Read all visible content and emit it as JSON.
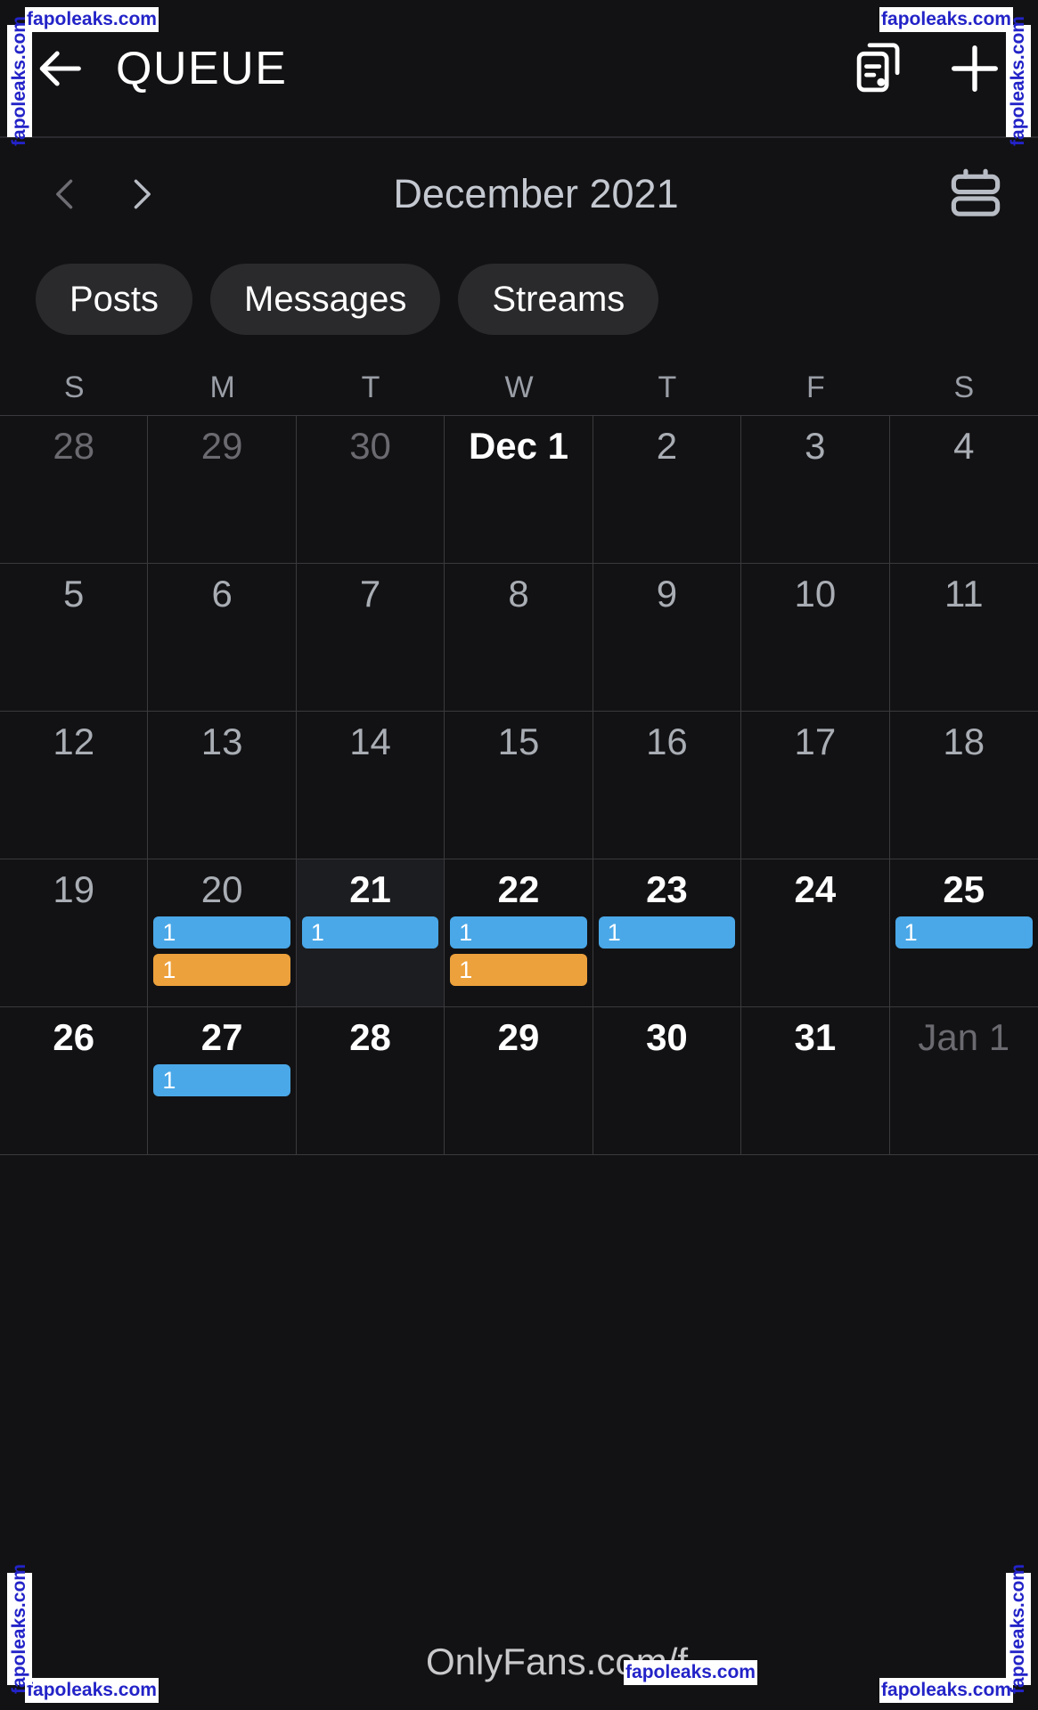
{
  "header": {
    "back_icon": "back-arrow-icon",
    "title": "QUEUE",
    "templates_icon": "post-templates-icon",
    "add_icon": "plus-icon"
  },
  "month_nav": {
    "prev_icon": "chevron-left-icon",
    "next_icon": "chevron-right-icon",
    "label": "December 2021",
    "view_toggle_icon": "agenda-view-icon"
  },
  "filters": [
    {
      "label": "Posts"
    },
    {
      "label": "Messages"
    },
    {
      "label": "Streams"
    }
  ],
  "weekdays": [
    "S",
    "M",
    "T",
    "W",
    "T",
    "F",
    "S"
  ],
  "colors": {
    "badge_blue": "#4aa8e8",
    "badge_orange": "#eda13c",
    "background": "#121214",
    "grid_line": "#3a3a3e",
    "today_cell": "#1c1d20"
  },
  "weeks": [
    [
      {
        "label": "28",
        "state": "muted",
        "badges": []
      },
      {
        "label": "29",
        "state": "muted",
        "badges": []
      },
      {
        "label": "30",
        "state": "muted",
        "badges": []
      },
      {
        "label": "Dec 1",
        "state": "normal",
        "badges": []
      },
      {
        "label": "2",
        "state": "dim",
        "badges": []
      },
      {
        "label": "3",
        "state": "dim",
        "badges": []
      },
      {
        "label": "4",
        "state": "dim",
        "badges": []
      }
    ],
    [
      {
        "label": "5",
        "state": "dim",
        "badges": []
      },
      {
        "label": "6",
        "state": "dim",
        "badges": []
      },
      {
        "label": "7",
        "state": "dim",
        "badges": []
      },
      {
        "label": "8",
        "state": "dim",
        "badges": []
      },
      {
        "label": "9",
        "state": "dim",
        "badges": []
      },
      {
        "label": "10",
        "state": "dim",
        "badges": []
      },
      {
        "label": "11",
        "state": "dim",
        "badges": []
      }
    ],
    [
      {
        "label": "12",
        "state": "dim",
        "badges": []
      },
      {
        "label": "13",
        "state": "dim",
        "badges": []
      },
      {
        "label": "14",
        "state": "dim",
        "badges": []
      },
      {
        "label": "15",
        "state": "dim",
        "badges": []
      },
      {
        "label": "16",
        "state": "dim",
        "badges": []
      },
      {
        "label": "17",
        "state": "dim",
        "badges": []
      },
      {
        "label": "18",
        "state": "dim",
        "badges": []
      }
    ],
    [
      {
        "label": "19",
        "state": "dim",
        "badges": []
      },
      {
        "label": "20",
        "state": "dim",
        "badges": [
          {
            "count": "1",
            "color": "blue"
          },
          {
            "count": "1",
            "color": "orange"
          }
        ]
      },
      {
        "label": "21",
        "state": "today",
        "badges": [
          {
            "count": "1",
            "color": "blue"
          }
        ]
      },
      {
        "label": "22",
        "state": "normal",
        "badges": [
          {
            "count": "1",
            "color": "blue"
          },
          {
            "count": "1",
            "color": "orange"
          }
        ]
      },
      {
        "label": "23",
        "state": "normal",
        "badges": [
          {
            "count": "1",
            "color": "blue"
          }
        ]
      },
      {
        "label": "24",
        "state": "normal",
        "badges": []
      },
      {
        "label": "25",
        "state": "normal",
        "badges": [
          {
            "count": "1",
            "color": "blue"
          }
        ]
      }
    ],
    [
      {
        "label": "26",
        "state": "normal",
        "badges": []
      },
      {
        "label": "27",
        "state": "normal",
        "badges": [
          {
            "count": "1",
            "color": "blue"
          }
        ]
      },
      {
        "label": "28",
        "state": "normal",
        "badges": []
      },
      {
        "label": "29",
        "state": "normal",
        "badges": []
      },
      {
        "label": "30",
        "state": "normal",
        "badges": []
      },
      {
        "label": "31",
        "state": "normal",
        "badges": []
      },
      {
        "label": "Jan 1",
        "state": "muted",
        "badges": []
      }
    ]
  ],
  "footer": {
    "url": "OnlyFans.com/f..."
  },
  "watermark": {
    "text": "fapoleaks.com"
  }
}
